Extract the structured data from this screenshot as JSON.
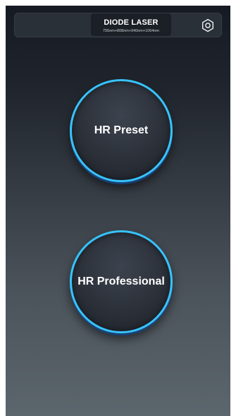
{
  "header": {
    "title": "DIODE LASER",
    "subtitle": "755nm+808nm+940nm+1064nm",
    "settings_icon": "gear-icon"
  },
  "main": {
    "buttons": [
      {
        "label": "HR Preset"
      },
      {
        "label": "HR Professional"
      }
    ]
  },
  "colors": {
    "accent": "#37c3ff",
    "title_text": "#ffffff",
    "background_top": "#161a22",
    "background_bottom": "#5c666d"
  }
}
